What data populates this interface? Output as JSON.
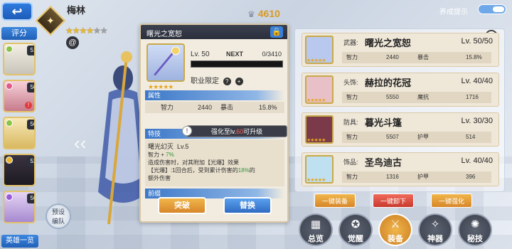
{
  "header": {
    "back_icon": "back-arrow-icon",
    "character_name": "梅林",
    "stars_filled": 4,
    "stars_total": 6,
    "class_badge_icon": "sage-class-icon",
    "faction_icon": "swirl-faction-icon",
    "power_value": "4610",
    "hint_label": "养成提示"
  },
  "left": {
    "rating_label": "评分",
    "roster": [
      {
        "level": "51",
        "element_color": "#8bc34a",
        "alert": false
      },
      {
        "level": "50",
        "element_color": "#e05a8a",
        "alert": true
      },
      {
        "level": "50",
        "element_color": "#8bc34a",
        "alert": false
      },
      {
        "level": "52",
        "element_color": "#e9b730",
        "alert": false
      },
      {
        "level": "50",
        "element_color": "#9a5ad8",
        "alert": false
      }
    ],
    "roster_list_label": "英雄一览",
    "preset_label_1": "预设",
    "preset_label_2": "编队"
  },
  "detail": {
    "title": "曙光之宽恕",
    "level": "Lv. 50",
    "next_label": "NEXT",
    "next_value": "0/3410",
    "job_limit_label": "职业限定",
    "attr_section": "属性",
    "attr_stat1_name": "智力",
    "attr_stat1_value": "2440",
    "attr_stat2_name": "暴击",
    "attr_stat2_value": "15.8%",
    "skill_section": "特技",
    "skill_name": "曙光幻灭",
    "skill_level": "Lv.5",
    "skill_line1_prefix": "智力 +",
    "skill_line1_value": "7%",
    "skill_line2": "造成伤害时，对其附加【光爆】效果",
    "skill_line3_prefix": "【光爆】:1回合后，受到累计伤害的",
    "skill_line3_value": "18%",
    "skill_line3_suffix": "的",
    "skill_line4": "额外伤害",
    "next_section": "前缀",
    "upgrade_tip_prefix": "强化至lv.",
    "upgrade_tip_level": "60",
    "upgrade_tip_suffix": "可升级",
    "break_button": "突破",
    "swap_button": "替换"
  },
  "equipment": [
    {
      "type": "武器:",
      "name": "曙光之宽恕",
      "level": "Lv. 50/50",
      "stat1_name": "智力",
      "stat1_value": "2440",
      "stat2_name": "暴击",
      "stat2_value": "15.8%",
      "color": "#b9c8ee"
    },
    {
      "type": "头饰:",
      "name": "赫拉的花冠",
      "level": "Lv. 40/40",
      "stat1_name": "智力",
      "stat1_value": "5550",
      "stat2_name": "魔抗",
      "stat2_value": "1716",
      "color": "#e8c0c8"
    },
    {
      "type": "防具:",
      "name": "暮光斗篷",
      "level": "Lv. 30/30",
      "stat1_name": "智力",
      "stat1_value": "5507",
      "stat2_name": "护甲",
      "stat2_value": "514",
      "color": "#7a3a4a"
    },
    {
      "type": "饰品:",
      "name": "圣鸟迪古",
      "level": "Lv. 40/40",
      "stat1_name": "智力",
      "stat1_value": "1316",
      "stat2_name": "护甲",
      "stat2_value": "396",
      "color": "#bfe0f0"
    }
  ],
  "actions": {
    "equip_all": "一键装备",
    "unequip_all": "一键卸下",
    "enhance_all": "一键强化"
  },
  "tabs": [
    {
      "label": "总览",
      "icon": "overview-icon",
      "active": false
    },
    {
      "label": "觉醒",
      "icon": "awaken-icon",
      "active": false
    },
    {
      "label": "装备",
      "icon": "equipment-icon",
      "active": true
    },
    {
      "label": "神器",
      "icon": "artifact-icon",
      "active": false
    },
    {
      "label": "秘技",
      "icon": "secret-skill-icon",
      "active": false
    }
  ]
}
